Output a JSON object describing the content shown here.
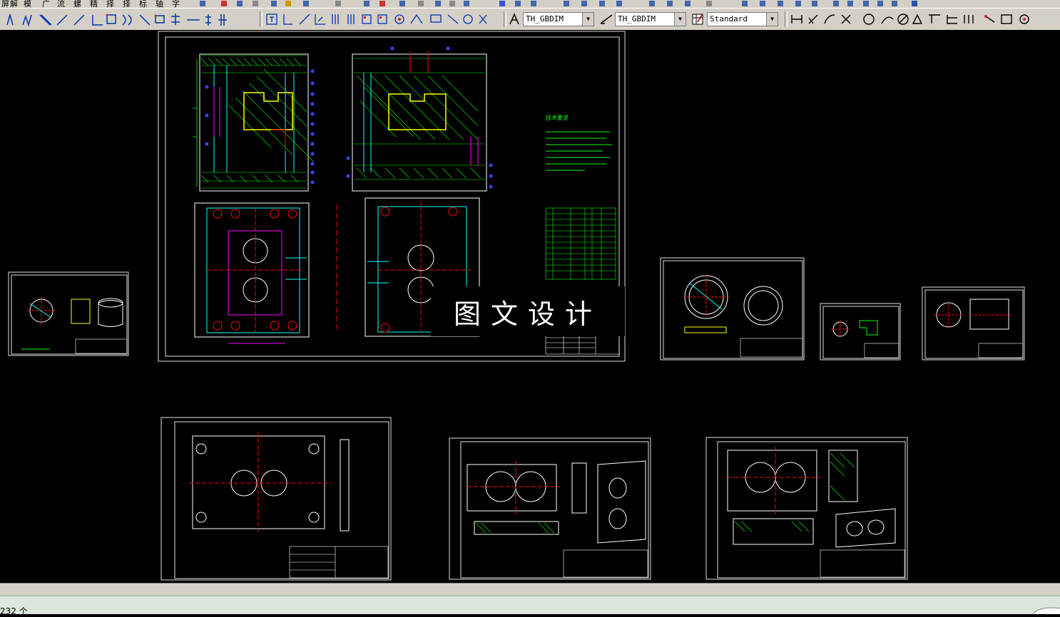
{
  "toolbar_top": {
    "menu_glyphs": [
      "屏",
      "解",
      "模",
      "广",
      "流",
      "螺",
      "精",
      "择",
      "择",
      "标",
      "轴",
      "字"
    ]
  },
  "toolbar_main": {
    "text_style_combo": "TH_GBDIM",
    "dim_style_combo": "TH_GBDIM",
    "table_style_combo": "Standard"
  },
  "drawing": {
    "watermark": "图文设计",
    "tech_req_title": "技术要求"
  },
  "status": {
    "text": "232 个"
  },
  "colors": {
    "canvas": "#000000",
    "line_white": "#ffffff",
    "line_cyan": "#00ffff",
    "line_yellow": "#ffff00",
    "line_green": "#00ff00",
    "line_red": "#ff0000",
    "line_magenta": "#ff00ff",
    "line_blue": "#4040ff"
  }
}
